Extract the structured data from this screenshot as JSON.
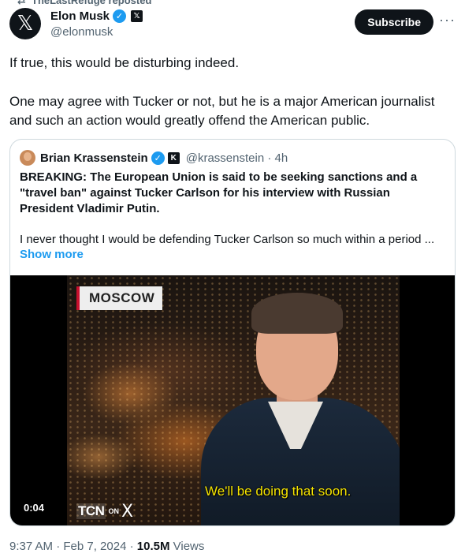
{
  "repost": {
    "label": "TheLastRefuge reposted"
  },
  "author": {
    "display_name": "Elon Musk",
    "handle": "@elonmusk",
    "avatar_letter": "𝕏",
    "affiliation_badge": "𝕏"
  },
  "subscribe_label": "Subscribe",
  "more_label": "···",
  "tweet": {
    "paragraph1": "If true, this would be disturbing indeed.",
    "paragraph2": "One may agree with Tucker or not, but he is a major American journalist and such an action would greatly offend the American public."
  },
  "quote": {
    "display_name": "Brian Krassenstein",
    "affiliation_badge": "K",
    "handle_time": "@krassenstein · 4h",
    "headline": "BREAKING:  The European Union is said to be seeking sanctions and a \"travel ban\" against Tucker Carlson for his interview with Russian President Vladimir Putin.",
    "body": "I never thought I would be defending Tucker Carlson so much within a period ...",
    "show_more": "Show more",
    "video": {
      "location_tag": "MOSCOW",
      "subtitle": "We'll be doing that soon.",
      "logo_text": "TCN",
      "logo_on": "ON",
      "logo_x": "X",
      "duration": "0:04"
    }
  },
  "meta": {
    "timestamp": "9:37 AM · Feb 7, 2024 · ",
    "views_count": "10.5M",
    "views_label": " Views"
  },
  "colors": {
    "accent": "#1d9bf0",
    "text": "#0f1419",
    "muted": "#536471",
    "subtitle": "#f5e400"
  }
}
